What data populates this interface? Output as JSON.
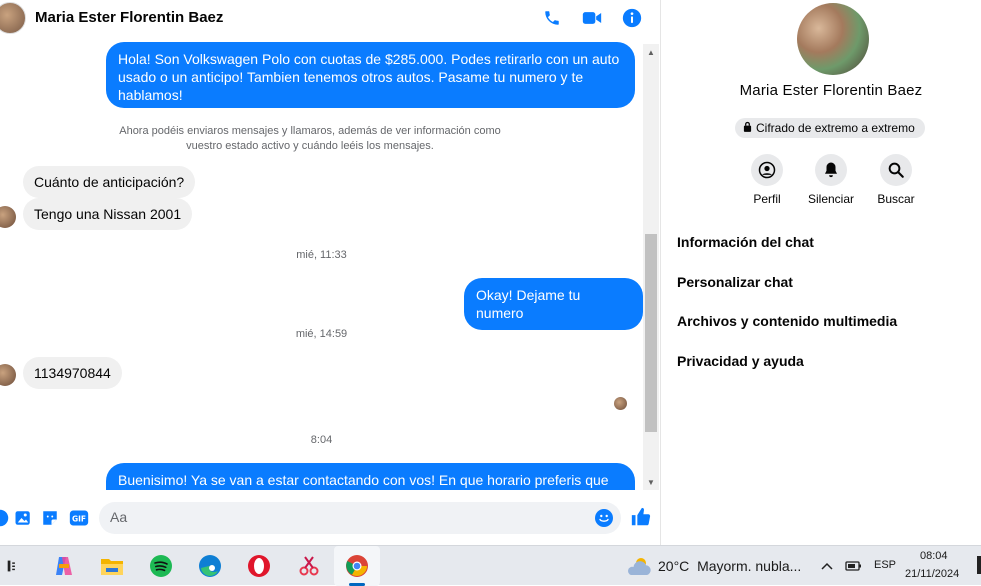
{
  "chat": {
    "contact_name": "Maria Ester Florentin Baez",
    "messages": {
      "out1": "Hola! Son Volkswagen Polo con cuotas de $285.000. Podes retirarlo con un auto usado o un anticipo! Tambien tenemos otros autos. Pasame tu numero y te hablamos!",
      "system_note": "Ahora podéis enviaros mensajes y llamaros, además de ver información como vuestro estado activo y cuándo leéis los mensajes.",
      "in1": "Cuánto de anticipación?",
      "in2": "Tengo una Nissan 2001",
      "time1": "mié, 11:33",
      "out2": "Okay! Dejame tu numero",
      "time2": "mié, 14:59",
      "in3": "1134970844",
      "time3": "8:04",
      "out3": "Buenisimo! Ya se van a estar contactando con vos! En que horario preferis que se"
    },
    "composer": {
      "placeholder": "Aa"
    }
  },
  "info_panel": {
    "name": "Maria Ester Florentin Baez",
    "e2e_badge": "Cifrado de extremo a extremo",
    "actions": [
      "Perfil",
      "Silenciar",
      "Buscar"
    ],
    "sections": [
      "Información del chat",
      "Personalizar chat",
      "Archivos y contenido multimedia",
      "Privacidad y ayuda"
    ]
  },
  "taskbar": {
    "weather_temp": "20°C",
    "weather_desc": "Mayorm. nubla...",
    "language": "ESP",
    "time": "08:04",
    "date": "21/11/2024"
  },
  "colors": {
    "accent": "#0a7cff",
    "bubble_in": "#f0f0f0"
  }
}
